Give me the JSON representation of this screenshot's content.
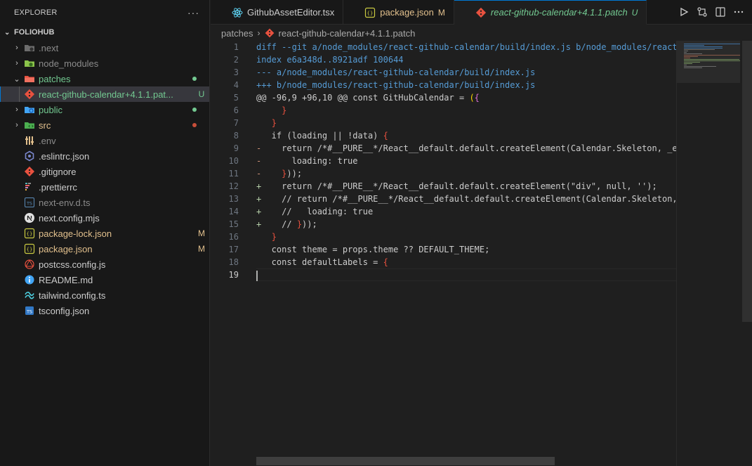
{
  "sidebar": {
    "title": "EXPLORER",
    "more_label": "···",
    "project": "FOLIOHUB",
    "items": [
      {
        "label": ".next",
        "chev": "›",
        "icon": "folder-next-icon",
        "color": "#8b8b8b",
        "depth": 0,
        "dot": "",
        "badge": ""
      },
      {
        "label": "node_modules",
        "chev": "›",
        "icon": "folder-node-icon",
        "color": "#8b8b8b",
        "depth": 0,
        "dot": "",
        "badge": ""
      },
      {
        "label": "patches",
        "chev": "⌄",
        "icon": "folder-patches-icon",
        "color": "#73c991",
        "depth": 0,
        "dot": "#73c991",
        "badge": ""
      },
      {
        "label": "react-github-calendar+4.1.1.pat...",
        "chev": "",
        "icon": "git-patch-file-icon",
        "color": "#73c991",
        "depth": 1,
        "dot": "",
        "badge": "U",
        "selected": true
      },
      {
        "label": "public",
        "chev": "›",
        "icon": "folder-public-icon",
        "color": "#73c991",
        "depth": 0,
        "dot": "#73c991",
        "badge": ""
      },
      {
        "label": "src",
        "chev": "›",
        "icon": "folder-src-icon",
        "color": "#e2c08d",
        "depth": 0,
        "dot": "#c74e39",
        "badge": ""
      },
      {
        "label": ".env",
        "chev": "",
        "icon": "env-file-icon",
        "color": "#8b8b8b",
        "depth": 0,
        "dot": "",
        "badge": ""
      },
      {
        "label": ".eslintrc.json",
        "chev": "",
        "icon": "eslint-file-icon",
        "color": "#cccccc",
        "depth": 0,
        "dot": "",
        "badge": ""
      },
      {
        "label": ".gitignore",
        "chev": "",
        "icon": "git-file-icon",
        "color": "#cccccc",
        "depth": 0,
        "dot": "",
        "badge": ""
      },
      {
        "label": ".prettierrc",
        "chev": "",
        "icon": "prettier-file-icon",
        "color": "#cccccc",
        "depth": 0,
        "dot": "",
        "badge": ""
      },
      {
        "label": "next-env.d.ts",
        "chev": "",
        "icon": "typescript-def-file-icon",
        "color": "#8b8b8b",
        "depth": 0,
        "dot": "",
        "badge": ""
      },
      {
        "label": "next.config.mjs",
        "chev": "",
        "icon": "next-file-icon",
        "color": "#cccccc",
        "depth": 0,
        "dot": "",
        "badge": ""
      },
      {
        "label": "package-lock.json",
        "chev": "",
        "icon": "json-file-icon",
        "color": "#e2c08d",
        "depth": 0,
        "dot": "",
        "badge": "M"
      },
      {
        "label": "package.json",
        "chev": "",
        "icon": "json-file-icon",
        "color": "#e2c08d",
        "depth": 0,
        "dot": "",
        "badge": "M"
      },
      {
        "label": "postcss.config.js",
        "chev": "",
        "icon": "postcss-file-icon",
        "color": "#cccccc",
        "depth": 0,
        "dot": "",
        "badge": ""
      },
      {
        "label": "README.md",
        "chev": "",
        "icon": "info-file-icon",
        "color": "#cccccc",
        "depth": 0,
        "dot": "",
        "badge": ""
      },
      {
        "label": "tailwind.config.ts",
        "chev": "",
        "icon": "tailwind-file-icon",
        "color": "#cccccc",
        "depth": 0,
        "dot": "",
        "badge": ""
      },
      {
        "label": "tsconfig.json",
        "chev": "",
        "icon": "tsconfig-file-icon",
        "color": "#cccccc",
        "depth": 0,
        "dot": "",
        "badge": ""
      }
    ]
  },
  "tabs": [
    {
      "label": "GithubAssetEditor.tsx",
      "icon": "react-icon",
      "status": "",
      "color": "#cccccc",
      "active": false
    },
    {
      "label": "package.json",
      "icon": "json-file-icon",
      "status": "M",
      "color": "#e2c08d",
      "active": false
    },
    {
      "label": "react-github-calendar+4.1.1.patch",
      "icon": "git-patch-file-icon",
      "status": "U",
      "color": "#73c991",
      "active": true
    }
  ],
  "tab_actions": [
    "run-icon",
    "compare-icon",
    "split-editor-icon",
    "more-icon"
  ],
  "breadcrumb": {
    "folder": "patches",
    "file": "react-github-calendar+4.1.1.patch",
    "sep": "›"
  },
  "editor": {
    "current_line": 19,
    "lines": [
      "diff --git a/node_modules/react-github-calendar/build/index.js b/node_modules/react",
      "index e6a348d..8921adf 100644",
      "--- a/node_modules/react-github-calendar/build/index.js",
      "+++ b/node_modules/react-github-calendar/build/index.js",
      "@@ -96,9 +96,10 @@ const GitHubCalendar = ({",
      "     }",
      "   }",
      "   if (loading || !data) {",
      "-    return /*#__PURE__*/React__default.default.createElement(Calendar.Skeleton, _e",
      "-      loading: true",
      "-    }));",
      "+    return /*#__PURE__*/React__default.default.createElement(\"div\", null, '');",
      "+    // return /*#__PURE__*/React__default.default.createElement(Calendar.Skeleton,",
      "+    //   loading: true",
      "+    // }));",
      "   }",
      "   const theme = props.theme ?? DEFAULT_THEME;",
      "   const defaultLabels = {",
      ""
    ]
  },
  "colors": {
    "accent": "#0078d4",
    "untracked": "#73c991",
    "modified": "#e2c08d",
    "deleted_dot": "#c74e39"
  }
}
